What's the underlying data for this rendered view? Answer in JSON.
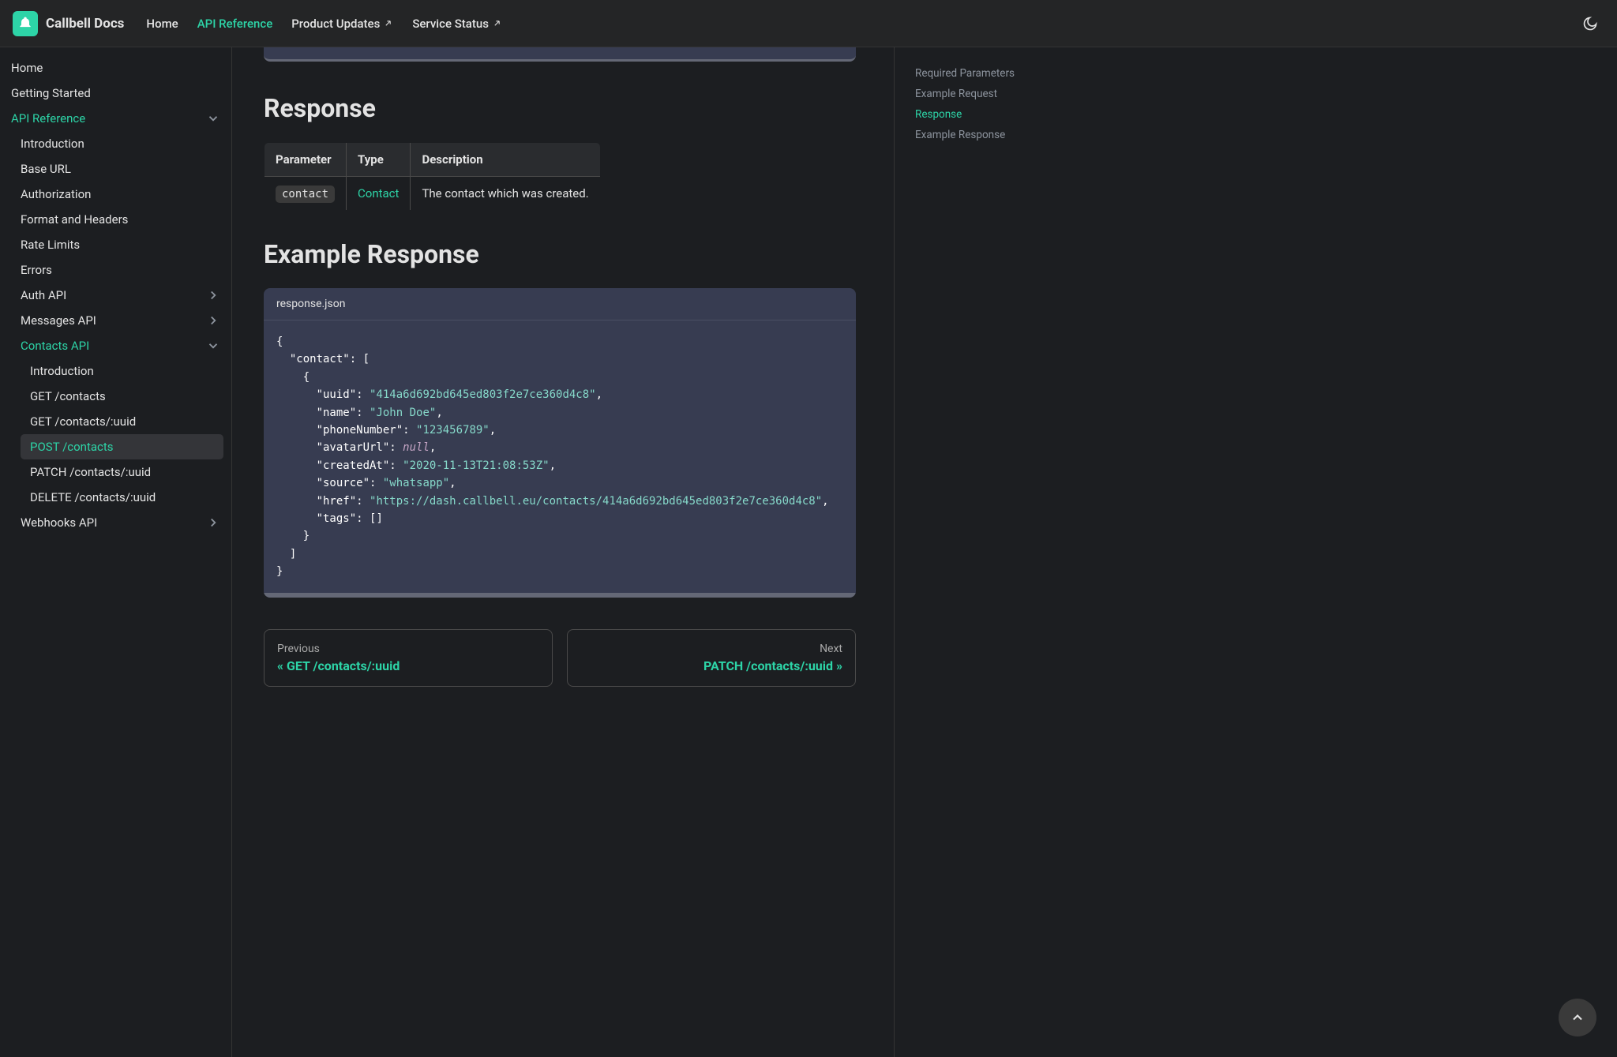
{
  "brand": "Callbell Docs",
  "nav": {
    "home": "Home",
    "api_ref": "API Reference",
    "product_updates": "Product Updates",
    "service_status": "Service Status"
  },
  "sidebar": {
    "home": "Home",
    "getting_started": "Getting Started",
    "api_reference": "API Reference",
    "introduction": "Introduction",
    "base_url": "Base URL",
    "authorization": "Authorization",
    "format_headers": "Format and Headers",
    "rate_limits": "Rate Limits",
    "errors": "Errors",
    "auth_api": "Auth API",
    "messages_api": "Messages API",
    "contacts_api": "Contacts API",
    "contacts_intro": "Introduction",
    "get_contacts": "GET /contacts",
    "get_contacts_uuid": "GET /contacts/:uuid",
    "post_contacts": "POST /contacts",
    "patch_contacts": "PATCH /contacts/:uuid",
    "delete_contacts": "DELETE /contacts/:uuid",
    "webhooks_api": "Webhooks API"
  },
  "headings": {
    "response": "Response",
    "example_response": "Example Response"
  },
  "table": {
    "h_parameter": "Parameter",
    "h_type": "Type",
    "h_description": "Description",
    "param": "contact",
    "type": "Contact",
    "desc": "The contact which was created."
  },
  "code": {
    "filename": "response.json",
    "uuid": "\"414a6d692bd645ed803f2e7ce360d4c8\"",
    "name": "\"John Doe\"",
    "phone": "\"123456789\"",
    "avatar_null": "null",
    "created_at": "\"2020-11-13T21:08:53Z\"",
    "source": "\"whatsapp\"",
    "href": "\"https://dash.callbell.eu/contacts/414a6d692bd645ed803f2e7ce360d4c8\""
  },
  "navcards": {
    "prev_label": "Previous",
    "prev_title": "« GET /contacts/:uuid",
    "next_label": "Next",
    "next_title": "PATCH /contacts/:uuid »"
  },
  "toc": {
    "required_params": "Required Parameters",
    "example_request": "Example Request",
    "response": "Response",
    "example_response": "Example Response"
  }
}
